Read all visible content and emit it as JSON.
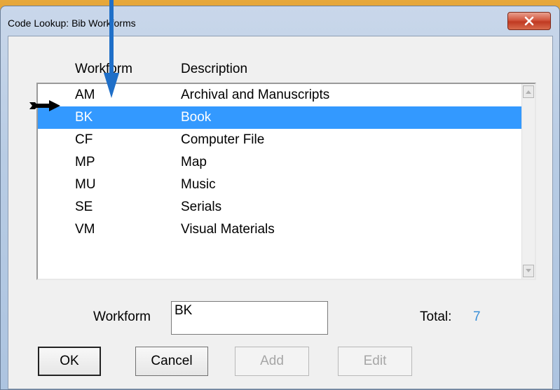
{
  "window": {
    "title": "Code Lookup: Bib Workforms",
    "close_icon": "close-icon"
  },
  "columns": {
    "code_header": "Workform",
    "description_header": "Description"
  },
  "rows": [
    {
      "code": "AM",
      "description": "Archival and Manuscripts",
      "selected": false
    },
    {
      "code": "BK",
      "description": "Book",
      "selected": true
    },
    {
      "code": "CF",
      "description": "Computer File",
      "selected": false
    },
    {
      "code": "MP",
      "description": "Map",
      "selected": false
    },
    {
      "code": "MU",
      "description": "Music",
      "selected": false
    },
    {
      "code": "SE",
      "description": "Serials",
      "selected": false
    },
    {
      "code": "VM",
      "description": "Visual Materials",
      "selected": false
    }
  ],
  "workform_field": {
    "label": "Workform",
    "value": "BK"
  },
  "total": {
    "label": "Total:",
    "value": "7"
  },
  "buttons": {
    "ok": "OK",
    "cancel": "Cancel",
    "add": "Add",
    "edit": "Edit"
  },
  "colors": {
    "selection": "#3399ff",
    "total_value": "#3a8fd8",
    "annotation_arrow": "#1f6fc8"
  }
}
